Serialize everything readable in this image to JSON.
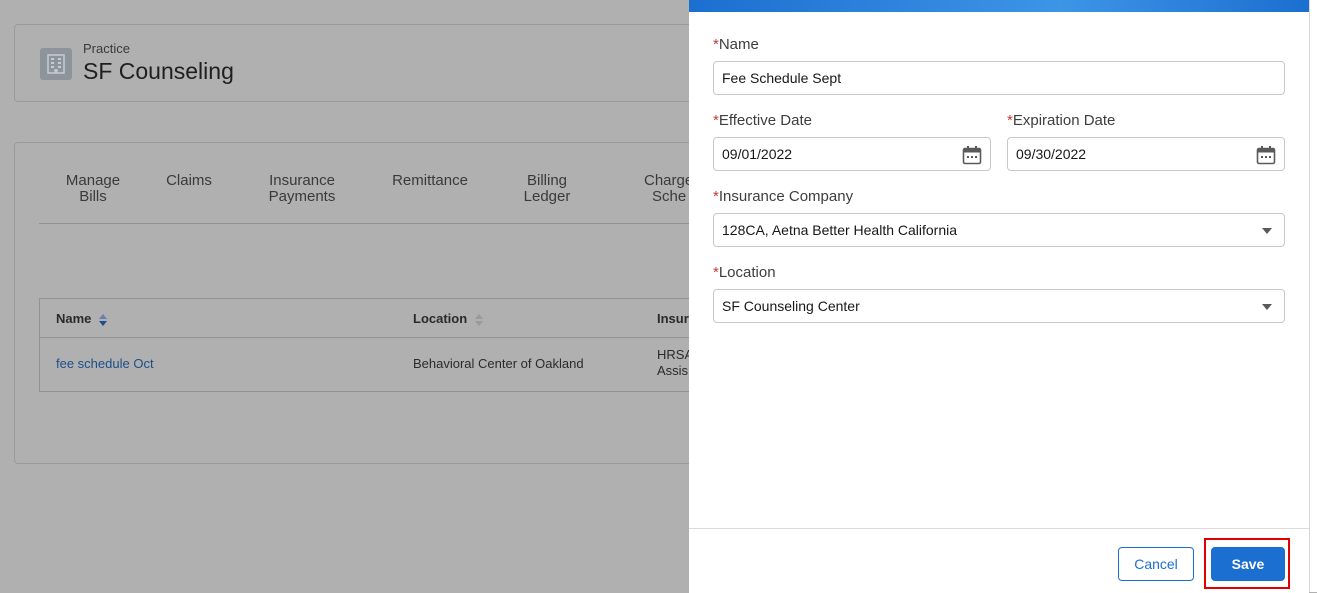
{
  "practice": {
    "label": "Practice",
    "name": "SF Counseling"
  },
  "tabs": [
    {
      "line1": "Manage",
      "line2": "Bills"
    },
    {
      "line1": "Claims",
      "line2": ""
    },
    {
      "line1": "Insurance",
      "line2": "Payments"
    },
    {
      "line1": "Remittance",
      "line2": ""
    },
    {
      "line1": "Billing",
      "line2": "Ledger"
    },
    {
      "line1": "Charge",
      "line2": "Sche"
    }
  ],
  "table": {
    "headers": [
      "Name",
      "Location",
      "Insura"
    ],
    "rows": [
      {
        "name": "fee schedule Oct",
        "location": "Behavioral Center of Oakland",
        "insurance_line1": "HRSA",
        "insurance_line2": "Assis"
      }
    ]
  },
  "form": {
    "required_mark": "*",
    "name_label": "Name",
    "name_value": "Fee Schedule Sept",
    "effective_label": "Effective Date",
    "effective_value": "09/01/2022",
    "expiration_label": "Expiration Date",
    "expiration_value": "09/30/2022",
    "insurance_label": "Insurance Company",
    "insurance_value": "128CA, Aetna Better Health California",
    "location_label": "Location",
    "location_value": "SF Counseling Center"
  },
  "footer": {
    "cancel_label": "Cancel",
    "save_label": "Save"
  },
  "colors": {
    "brand": "#1b6fd0",
    "required": "#c23934",
    "highlight": "#e00000"
  }
}
